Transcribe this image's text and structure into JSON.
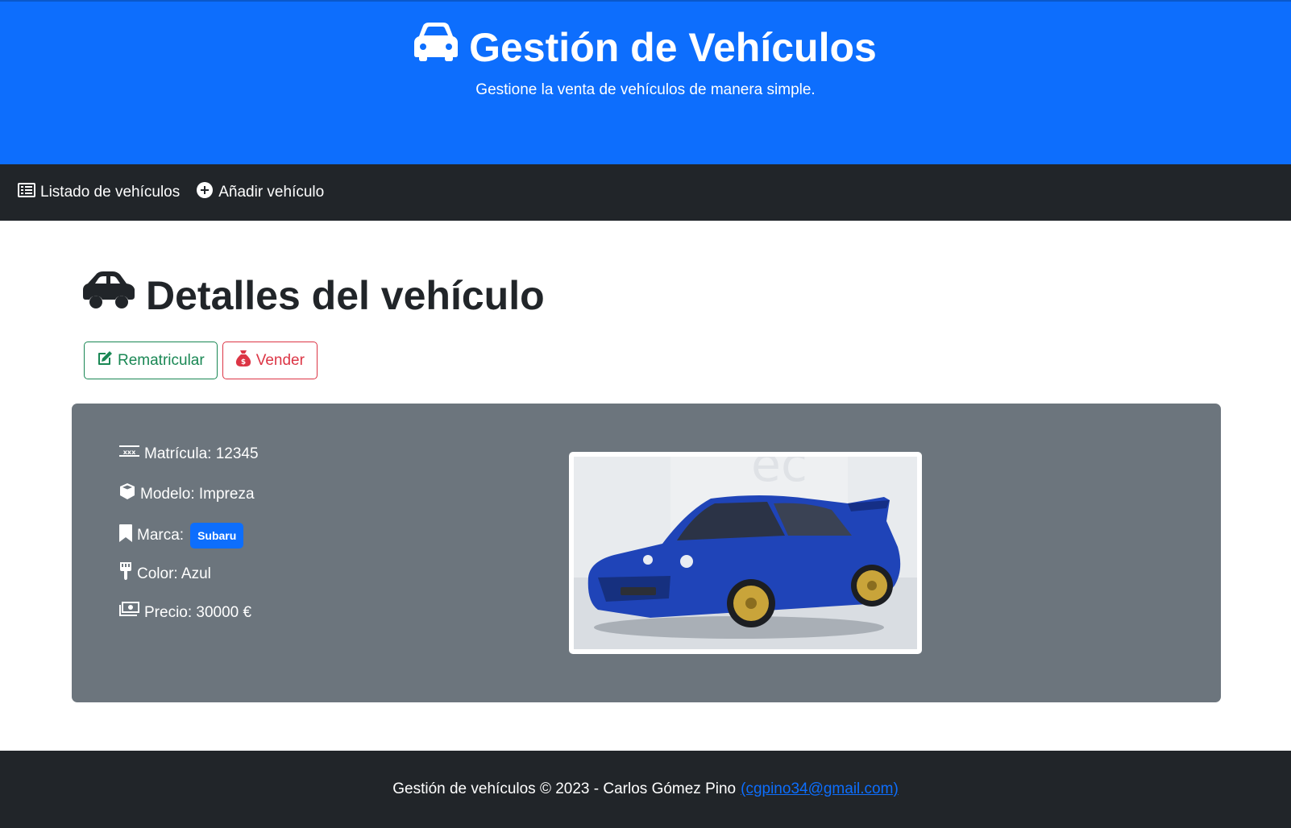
{
  "header": {
    "title": "Gestión de Vehículos",
    "subtitle": "Gestione la venta de vehículos de manera simple.",
    "icon": "car-icon"
  },
  "nav": {
    "items": [
      {
        "label": "Listado de vehículos",
        "icon": "list-icon"
      },
      {
        "label": "Añadir vehículo",
        "icon": "plus-circle-icon"
      }
    ]
  },
  "main": {
    "title": "Detalles del vehículo",
    "icon": "car-icon",
    "actions": {
      "rematricular": "Rematricular",
      "vender": "Vender"
    },
    "details": {
      "matricula": "Matrícula: 12345",
      "modelo": "Modelo: Impreza",
      "marca_label": "Marca:",
      "marca_badge": "Subaru",
      "color": "Color: Azul",
      "precio": "Precio: 30000 €"
    },
    "image_alt": "Subaru Impreza azul"
  },
  "footer": {
    "text": "Gestión de vehículos © 2023 - Carlos Gómez Pino",
    "email_link": "(cgpino34@gmail.com)"
  },
  "colors": {
    "primary": "#0d6efd",
    "dark": "#212529",
    "secondary": "#6c757d",
    "success": "#198754",
    "danger": "#dc3545"
  }
}
